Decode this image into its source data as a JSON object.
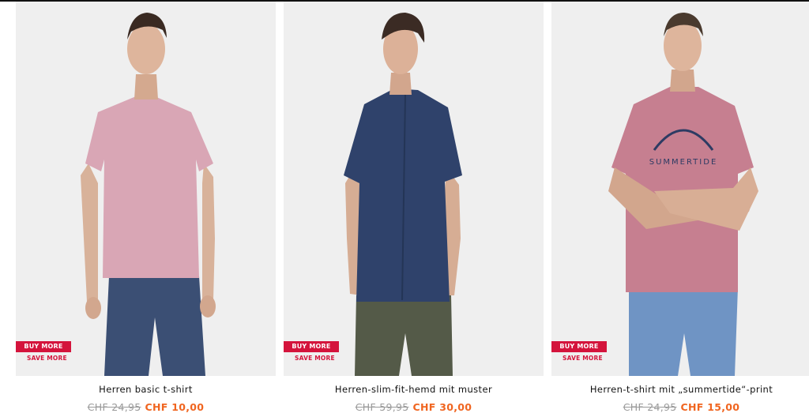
{
  "products": [
    {
      "title": "Herren basic t-shirt",
      "old_price": "CHF 24,95",
      "new_price": "CHF 10,00",
      "badge": "BUY MORE",
      "badge_sub": "SAVE MORE",
      "image": "man-in-pink-basic-tshirt-and-jeans",
      "shirt_color": "#d9a6b5"
    },
    {
      "title": "Herren-slim-fit-hemd mit muster",
      "old_price": "CHF 59,95",
      "new_price": "CHF 30,00",
      "badge": "BUY MORE",
      "badge_sub": "SAVE MORE",
      "image": "man-in-navy-patterned-shirt-and-olive-chinos",
      "shirt_color": "#2f426b"
    },
    {
      "title": "Herren-t-shirt mit „summertide“-print",
      "old_price": "CHF 24,95",
      "new_price": "CHF 15,00",
      "badge": "BUY MORE",
      "badge_sub": "SAVE MORE",
      "image": "man-in-pink-summertide-print-tshirt",
      "shirt_color": "#c67f90",
      "print_text": "SUMMERTIDE"
    }
  ],
  "colors": {
    "badge": "#d4143c",
    "sale_price": "#f06520",
    "old_price": "#9a9a9a"
  }
}
